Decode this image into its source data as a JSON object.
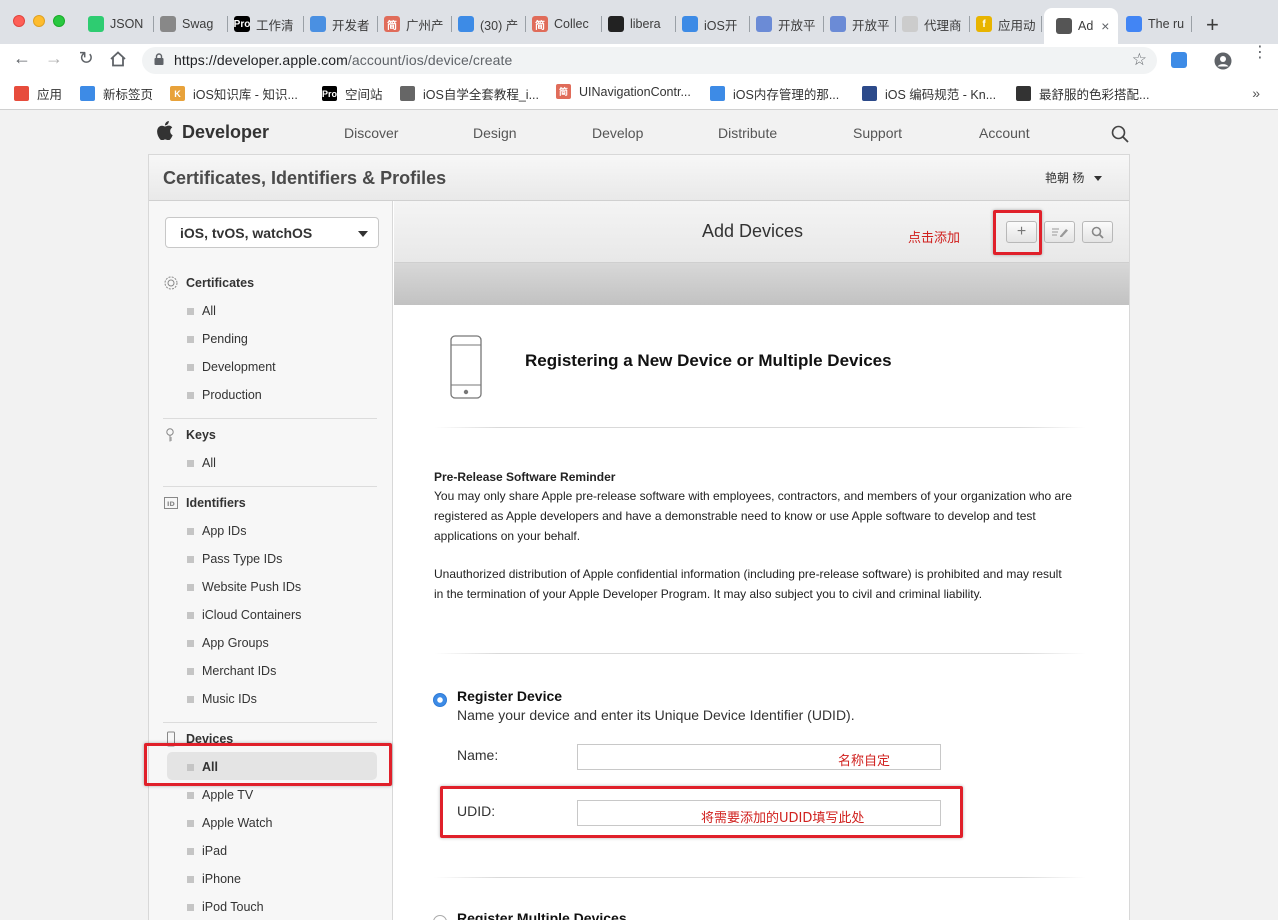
{
  "browser": {
    "tabs": [
      {
        "label": "JSON",
        "favicon_color": "#2ecc71"
      },
      {
        "label": "Swag",
        "favicon_color": "#888888"
      },
      {
        "label": "工作清",
        "favicon_color": "#000000",
        "favicon_text": "Pro"
      },
      {
        "label": "开发者",
        "favicon_color": "#4a90e2"
      },
      {
        "label": "广州产",
        "favicon_color": "#e06c5a",
        "favicon_text": "简"
      },
      {
        "label": "(30) 产",
        "favicon_color": "#3d8be6"
      },
      {
        "label": "Collec",
        "favicon_color": "#e06c5a",
        "favicon_text": "简"
      },
      {
        "label": "libera",
        "favicon_color": "#222222"
      },
      {
        "label": "iOS开",
        "favicon_color": "#3d8be6"
      },
      {
        "label": "开放平",
        "favicon_color": "#6b8bd6"
      },
      {
        "label": "开放平",
        "favicon_color": "#6b8bd6"
      },
      {
        "label": "代理商",
        "favicon_color": "#cccccc"
      },
      {
        "label": "应用动",
        "favicon_color": "#e8b400",
        "favicon_text": "f"
      },
      {
        "label": "Ad",
        "favicon_color": "#555555",
        "active": true
      },
      {
        "label": "The ru",
        "favicon_color": "#4285f4"
      }
    ],
    "url_host": "https://developer.apple.com",
    "url_path": "/account/ios/device/create",
    "bookmarks": [
      {
        "label": "应用",
        "color": "#e74c3c"
      },
      {
        "label": "新标签页",
        "color": "#3d8be6"
      },
      {
        "label": "iOS知识库 - 知识...",
        "color": "#e8a23a",
        "text": "K"
      },
      {
        "label": "空间站",
        "color": "#000000",
        "text": "Pro"
      },
      {
        "label": "iOS自学全套教程_i...",
        "color": "#666666"
      },
      {
        "label": "UINavigationContr...",
        "color": "#e06c5a",
        "text": "简"
      },
      {
        "label": "iOS内存管理的那...",
        "color": "#3d8be6"
      },
      {
        "label": "iOS 编码规范 - Kn...",
        "color": "#2c4a8a"
      },
      {
        "label": "最舒服的色彩搭配...",
        "color": "#333333"
      }
    ],
    "more": "»"
  },
  "header": {
    "brand": "Developer",
    "nav": [
      "Discover",
      "Design",
      "Develop",
      "Distribute",
      "Support",
      "Account"
    ]
  },
  "panel": {
    "title": "Certificates, Identifiers & Profiles",
    "user": "艳朝 杨"
  },
  "sidebar": {
    "platform": "iOS, tvOS, watchOS",
    "sections": [
      {
        "title": "Certificates",
        "icon": "certificate-icon",
        "items": [
          "All",
          "Pending",
          "Development",
          "Production"
        ]
      },
      {
        "title": "Keys",
        "icon": "key-icon",
        "items": [
          "All"
        ]
      },
      {
        "title": "Identifiers",
        "icon": "id-icon",
        "items": [
          "App IDs",
          "Pass Type IDs",
          "Website Push IDs",
          "iCloud Containers",
          "App Groups",
          "Merchant IDs",
          "Music IDs"
        ]
      },
      {
        "title": "Devices",
        "icon": "device-icon",
        "items": [
          "All",
          "Apple TV",
          "Apple Watch",
          "iPad",
          "iPhone",
          "iPod Touch"
        ],
        "active_item": "All"
      }
    ]
  },
  "main": {
    "title": "Add Devices",
    "register_title": "Registering a New Device or Multiple Devices",
    "reminder_title": "Pre-Release Software Reminder",
    "reminder_text": "You may only share Apple pre-release software with employees, contractors, and members of your organization who are registered as Apple developers and have a demonstrable need to know or use Apple software to develop and test applications on your behalf.",
    "unauthorized_text": "Unauthorized distribution of Apple confidential information (including pre-release software) is prohibited and may result in the termination of your Apple Developer Program. It may also subject you to civil and criminal liability.",
    "option_single": {
      "title": "Register Device",
      "desc": "Name your device and enter its Unique Device Identifier (UDID).",
      "selected": true
    },
    "name_label": "Name:",
    "udid_label": "UDID:",
    "name_value": "",
    "udid_value": "",
    "option_multiple": {
      "title": "Register Multiple Devices",
      "selected": false
    }
  },
  "annotations": {
    "add": "点击添加",
    "name": "名称自定",
    "udid": "将需要添加的UDID填写此处",
    "color": "#e0202a"
  }
}
